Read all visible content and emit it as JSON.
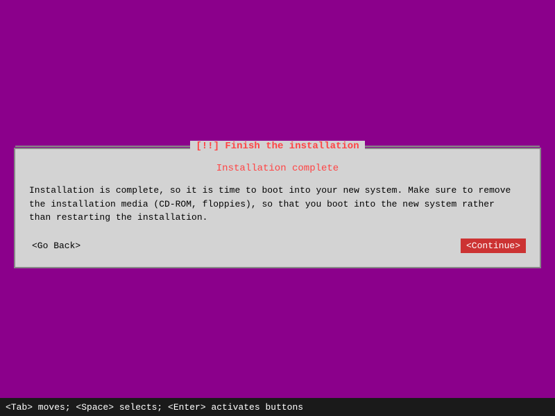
{
  "title_bar": {
    "text": "[!!] Finish the installation"
  },
  "dialog": {
    "heading": "Installation complete",
    "body": "Installation is complete, so it is time to boot into your new system. Make sure to remove\nthe installation media (CD-ROM, floppies), so that you boot into the new system rather\nthan restarting the installation.",
    "back_button": "<Go Back>",
    "continue_button": "<Continue>"
  },
  "status_bar": {
    "text": "<Tab> moves; <Space> selects; <Enter> activates buttons"
  }
}
